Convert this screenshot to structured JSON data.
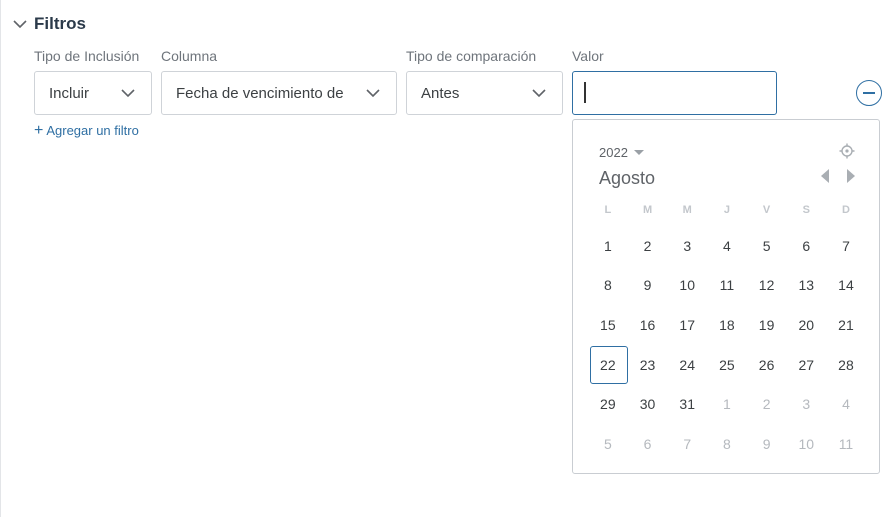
{
  "section": {
    "title": "Filtros",
    "icon": "chevron-down-icon"
  },
  "labels": {
    "inclusion": "Tipo de Inclusión",
    "column": "Columna",
    "comparison": "Tipo de comparación",
    "value": "Valor"
  },
  "fields": {
    "inclusion": "Incluir",
    "column": "Fecha de vencimiento de",
    "comparison": "Antes",
    "value": ""
  },
  "add_filter": {
    "plus": "+",
    "label": "Agregar un filtro"
  },
  "calendar": {
    "year": "2022",
    "month": "Agosto",
    "weekdays": [
      "L",
      "M",
      "M",
      "J",
      "V",
      "S",
      "D"
    ],
    "days": [
      {
        "d": "1"
      },
      {
        "d": "2"
      },
      {
        "d": "3"
      },
      {
        "d": "4"
      },
      {
        "d": "5"
      },
      {
        "d": "6"
      },
      {
        "d": "7"
      },
      {
        "d": "8"
      },
      {
        "d": "9"
      },
      {
        "d": "10"
      },
      {
        "d": "11"
      },
      {
        "d": "12"
      },
      {
        "d": "13"
      },
      {
        "d": "14"
      },
      {
        "d": "15"
      },
      {
        "d": "16"
      },
      {
        "d": "17"
      },
      {
        "d": "18"
      },
      {
        "d": "19"
      },
      {
        "d": "20"
      },
      {
        "d": "21"
      },
      {
        "d": "22",
        "selected": true
      },
      {
        "d": "23"
      },
      {
        "d": "24"
      },
      {
        "d": "25"
      },
      {
        "d": "26"
      },
      {
        "d": "27"
      },
      {
        "d": "28"
      },
      {
        "d": "29"
      },
      {
        "d": "30"
      },
      {
        "d": "31"
      },
      {
        "d": "1",
        "muted": true
      },
      {
        "d": "2",
        "muted": true
      },
      {
        "d": "3",
        "muted": true
      },
      {
        "d": "4",
        "muted": true
      },
      {
        "d": "5",
        "muted": true
      },
      {
        "d": "6",
        "muted": true
      },
      {
        "d": "7",
        "muted": true
      },
      {
        "d": "8",
        "muted": true
      },
      {
        "d": "9",
        "muted": true
      },
      {
        "d": "10",
        "muted": true
      },
      {
        "d": "11",
        "muted": true
      }
    ]
  },
  "colors": {
    "accent": "#2f6fa3",
    "muted": "#b5b9be",
    "border": "#cfd3d8"
  }
}
